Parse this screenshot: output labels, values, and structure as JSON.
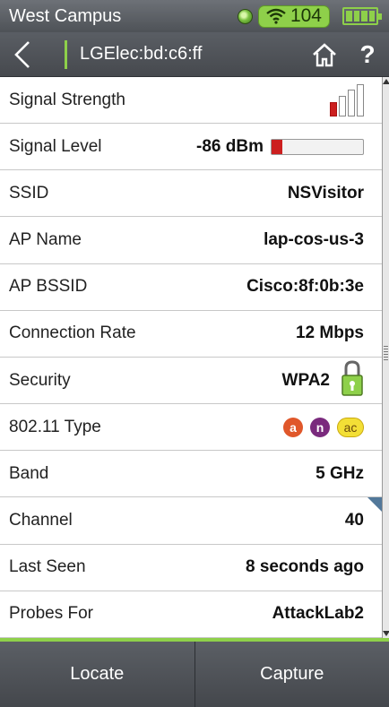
{
  "status": {
    "location": "West Campus",
    "wifi_count": "104"
  },
  "titlebar": {
    "title": "LGElec:bd:c6:ff",
    "help": "?"
  },
  "colors": {
    "accent_green": "#8ed04a",
    "signal_red": "#cc1f1f",
    "header_gray": "#4e5257"
  },
  "signal": {
    "bars_total": 4,
    "bars_on": 1,
    "level_fraction": 0.12
  },
  "rows": [
    {
      "label": "Signal Strength",
      "value": ""
    },
    {
      "label": "Signal Level",
      "value": "-86 dBm"
    },
    {
      "label": "SSID",
      "value": "NSVisitor"
    },
    {
      "label": "AP Name",
      "value": "lap-cos-us-3"
    },
    {
      "label": "AP BSSID",
      "value": "Cisco:8f:0b:3e"
    },
    {
      "label": "Connection Rate",
      "value": "12 Mbps"
    },
    {
      "label": "Security",
      "value": "WPA2"
    },
    {
      "label": "802.11 Type",
      "value": ""
    },
    {
      "label": "Band",
      "value": "5 GHz"
    },
    {
      "label": "Channel",
      "value": "40"
    },
    {
      "label": "Last Seen",
      "value": "8  seconds ago"
    },
    {
      "label": "Probes For",
      "value": "AttackLab2"
    }
  ],
  "types": [
    "a",
    "n",
    "ac"
  ],
  "icons": [
    "status-dot-icon",
    "wifi-icon",
    "battery-icon",
    "back-arrow-icon",
    "home-icon",
    "lock-icon"
  ],
  "bottom": {
    "locate": "Locate",
    "capture": "Capture"
  }
}
